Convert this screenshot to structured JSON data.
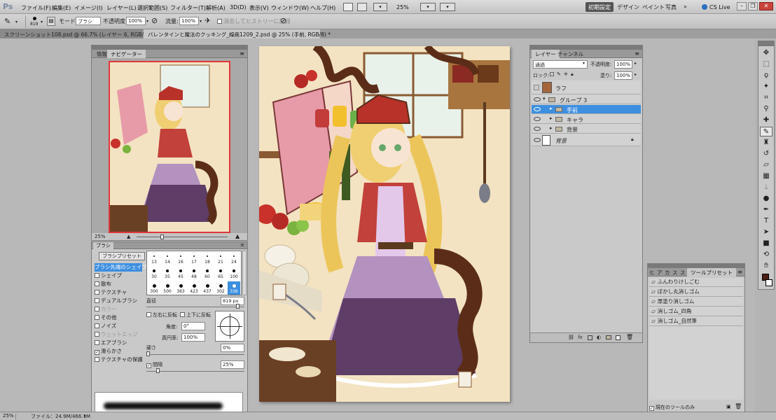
{
  "menubar": {
    "logo": "Ps",
    "items": [
      "ファイル(F)",
      "編集(E)",
      "イメージ(I)",
      "レイヤー(L)",
      "選択範囲(S)",
      "フィルター(T)",
      "解析(A)",
      "3D(D)",
      "表示(V)",
      "ウィンドウ(W)",
      "ヘルプ(H)"
    ],
    "zoom": "25%",
    "workspaces": [
      "初期設定",
      "デザイン",
      "ペイント",
      "写真"
    ],
    "cslive": "CS Live"
  },
  "options": {
    "brush_size": "819",
    "mode_label": "モード:",
    "mode_value": "ブラシ",
    "opacity_label": "不透明度:",
    "opacity_value": "100%",
    "flow_label": "流量:",
    "flow_value": "100%",
    "history_label": "消去してヒストリーに記録"
  },
  "doc_tabs": [
    "スクリーンショット108.psd @ 66.7% (レイヤー 6, RGB/8) ×",
    "バレンタインと魔法のクッキング_線画1209_2.psd @ 25% (手前, RGB/8) *"
  ],
  "navigator": {
    "tabs": [
      "情報",
      "ナビゲーター"
    ],
    "zoom": "25%"
  },
  "brush": {
    "title": "ブラシ",
    "preset_button": "ブラシプリセット",
    "options": [
      {
        "label": "ブラシ先端のシェイプ",
        "checked": false,
        "selected": true
      },
      {
        "label": "シェイプ",
        "checked": false
      },
      {
        "label": "散布",
        "checked": false
      },
      {
        "label": "テクスチャ",
        "checked": false
      },
      {
        "label": "デュアルブラシ",
        "checked": false
      },
      {
        "label": "カラー",
        "checked": false,
        "disabled": true
      },
      {
        "label": "その他",
        "checked": false
      },
      {
        "label": "ノイズ",
        "checked": false
      },
      {
        "label": "ウェットエッジ",
        "checked": false,
        "disabled": true
      },
      {
        "label": "エアブラシ",
        "checked": false
      },
      {
        "label": "滑らかさ",
        "checked": true
      },
      {
        "label": "テクスチャの保護",
        "checked": false
      }
    ],
    "sizes": [
      "13",
      "14",
      "16",
      "17",
      "18",
      "21",
      "24",
      "30",
      "35",
      "45",
      "48",
      "60",
      "65",
      "100",
      "300",
      "500",
      "363",
      "423",
      "437",
      "302",
      "336"
    ],
    "diameter_label": "直径",
    "diameter_value": "819 px",
    "flip_x": "左右に反転",
    "flip_y": "上下に反転",
    "angle_label": "角度:",
    "angle_value": "0°",
    "roundness_label": "真円率:",
    "roundness_value": "100%",
    "hardness_label": "硬さ",
    "hardness_value": "0%",
    "spacing_label": "間隔",
    "spacing_value": "25%"
  },
  "layers": {
    "tabs": [
      "レイヤー",
      "チャンネル"
    ],
    "blend_mode": "通過",
    "opacity_label": "不透明度:",
    "opacity_value": "100%",
    "lock_label": "ロック:",
    "fill_label": "塗り:",
    "fill_value": "100%",
    "items": [
      {
        "name": "ラフ",
        "type": "layer",
        "indent": 0,
        "visible": false,
        "selected": false
      },
      {
        "name": "グループ 3",
        "type": "group",
        "indent": 0,
        "visible": true,
        "selected": false,
        "expanded": true
      },
      {
        "name": "手前",
        "type": "group",
        "indent": 1,
        "visible": true,
        "selected": true
      },
      {
        "name": "キャラ",
        "type": "group",
        "indent": 1,
        "visible": true,
        "selected": false
      },
      {
        "name": "背景",
        "type": "group",
        "indent": 1,
        "visible": true,
        "selected": false
      },
      {
        "name": "背景",
        "type": "layer",
        "indent": 0,
        "visible": true,
        "selected": false,
        "locked": true
      }
    ]
  },
  "tool_presets": {
    "tabs": [
      "ヒ",
      "ア",
      "カ",
      "ス",
      "ス",
      "ツールプリセット"
    ],
    "items": [
      "ふんわりけしごむ",
      "ぼかし丸消しゴム",
      "厚塗り消しゴム",
      "消しゴム_四角",
      "消しゴム_自然筆"
    ],
    "current_only": "現在のツールのみ"
  },
  "status": {
    "zoom": "25%",
    "file_info": "ファイル：24.9M/466.1M"
  },
  "colors": {
    "foreground": "#4a1e14",
    "background": "#ffffff",
    "selection": "#3d8fe0"
  }
}
